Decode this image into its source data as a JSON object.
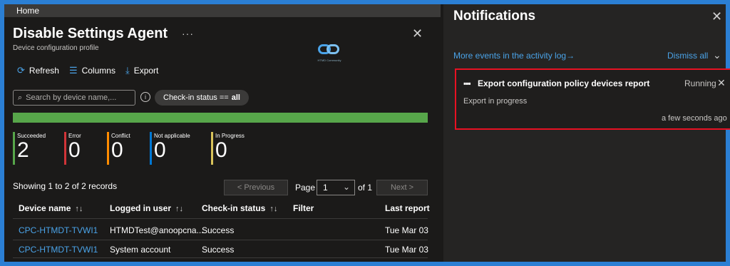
{
  "breadcrumb": {
    "home": "Home"
  },
  "blade": {
    "title": "Disable Settings Agent",
    "subtitle": "Device configuration profile",
    "more_label": "···",
    "close_label": "✕"
  },
  "toolbar": {
    "refresh_label": "Refresh",
    "columns_label": "Columns",
    "export_label": "Export"
  },
  "search": {
    "placeholder": "Search by device name,..."
  },
  "filter": {
    "prefix": "Check-in status == ",
    "value": "all"
  },
  "progress": {
    "succeeded_fraction": 1.0,
    "color": "#57a64a"
  },
  "stats": [
    {
      "label": "Succeeded",
      "value": "2",
      "color": "#57a64a"
    },
    {
      "label": "Error",
      "value": "0",
      "color": "#d13438"
    },
    {
      "label": "Conflict",
      "value": "0",
      "color": "#ff8c00"
    },
    {
      "label": "Not applicable",
      "value": "0",
      "color": "#0078d4"
    },
    {
      "label": "In Progress",
      "value": "0",
      "color": "#d8c35a"
    }
  ],
  "pagination": {
    "records_text": "Showing 1 to 2 of 2 records",
    "previous_label": "< Previous",
    "page_label": "Page",
    "current_page": "1",
    "of_label": "of 1",
    "next_label": "Next >"
  },
  "table": {
    "columns": [
      "Device name",
      "Logged in user",
      "Check-in status",
      "Filter",
      "Last report"
    ],
    "rows": [
      {
        "device": "CPC-HTMDT-TVWI1",
        "user": "HTMDTest@anoopcna...",
        "status": "Success",
        "filter": "",
        "last_report": "Tue Mar 03"
      },
      {
        "device": "CPC-HTMDT-TVWI1",
        "user": "System account",
        "status": "Success",
        "filter": "",
        "last_report": "Tue Mar 03"
      }
    ]
  },
  "notifications": {
    "title": "Notifications",
    "more_events": "More events in the activity log→",
    "dismiss_all": "Dismiss all",
    "items": [
      {
        "title": "Export configuration policy devices report",
        "status": "Running",
        "message": "Export in progress",
        "time": "a few seconds ago"
      }
    ]
  },
  "logo": {
    "caption": "HTMD Community"
  }
}
